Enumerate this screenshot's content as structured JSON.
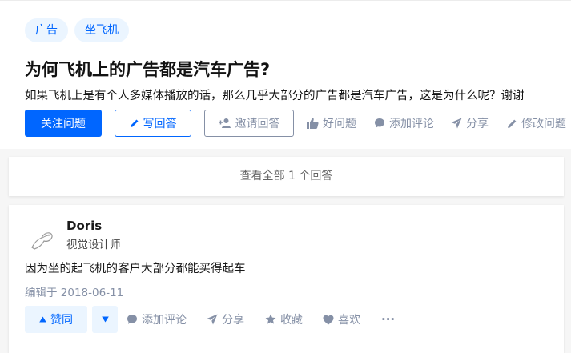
{
  "question": {
    "tags": [
      "广告",
      "坐飞机"
    ],
    "title": "为何飞机上的广告都是汽车广告?",
    "detail": "如果飞机上是有个人多媒体播放的话，那么几乎大部分的广告都是汽车广告，这是为什么呢？谢谢",
    "follow_label": "关注问题",
    "write_answer_label": "写回答",
    "invite_label": "邀请回答",
    "good_question_label": "好问题",
    "add_comment_label": "添加评论",
    "share_label": "分享",
    "edit_label": "修改问题"
  },
  "view_all_label": "查看全部 1 个回答",
  "answer": {
    "author_name": "Doris",
    "author_bio": "视觉设计师",
    "content": "因为坐的起飞机的客户大部分都能买得起车",
    "edited_time": "编辑于 2018-06-11",
    "upvote_label": "赞同",
    "add_comment_label": "添加评论",
    "share_label": "分享",
    "collect_label": "收藏",
    "like_label": "喜欢",
    "more_label": "···"
  },
  "colors": {
    "primary": "#0066ff",
    "muted": "#8590a6",
    "tag_bg": "#ebf5ff"
  }
}
